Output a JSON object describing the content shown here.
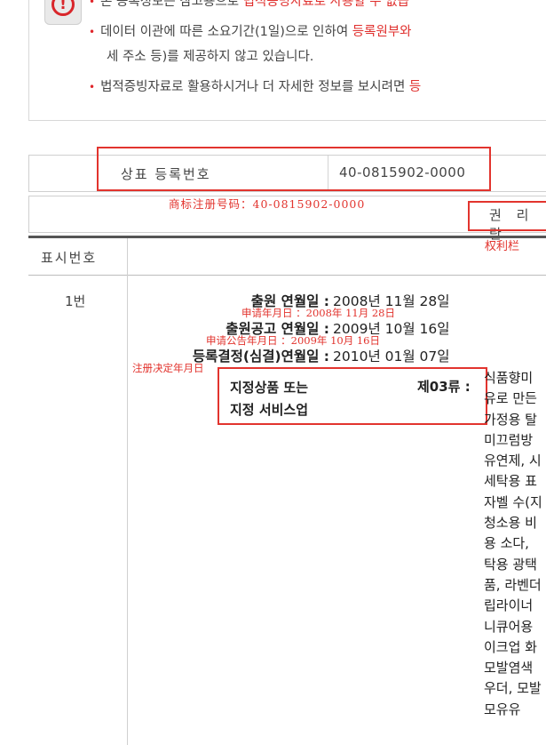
{
  "notice": {
    "line1_pre": "본 등록정보는 참고용으로 ",
    "line1_red": "법적증빙자료로 사용할 수 없습",
    "line2_pre": "데이터 이관에 따른 소요기간(1일)으로 인하여 ",
    "line2_red": "등록원부와",
    "line3": "세 주소 등)를 제공하지 않고 있습니다.",
    "line4_pre": "법적증빙자료로 활용하시거나 더 자세한 정보를 보시려면 ",
    "line4_red": "등",
    "alert_icon": "exclamation-circle"
  },
  "registration": {
    "label": "상표 등록번호",
    "value": "40-0815902-0000",
    "annotation": "商标注册号码：40-0815902-0000"
  },
  "rights": {
    "label": "권 리 란",
    "annotation": "权利栏"
  },
  "table": {
    "header_display": "표시번호",
    "row_number": "1번",
    "dates": [
      {
        "label": "출원 연월일 :",
        "value": "2008년 11월 28일",
        "annotation": "申请年月日 ：2008年 11月 28日"
      },
      {
        "label": "출원공고 연월일 :",
        "value": "2009년 10월 16일",
        "annotation": "申请公告年月日 ：2009年 10月 16日"
      },
      {
        "label": "등록결정(심결)연월일 :",
        "value": "2010년 01월 07일",
        "annotation": "注册决定年月日"
      }
    ],
    "goods_label_1": "지정상품 또는",
    "goods_label_2": "지정 서비스업",
    "class_label": "제03류 :",
    "goods_lines": [
      "식품향미",
      "유로 만든",
      "가정용 탈",
      "미끄럼방",
      "유연제, 시",
      "세탁용 표",
      "자벨 수(지",
      "청소용 비",
      "용 소다,",
      "탁용 광택",
      "품, 라벤더",
      "립라이너",
      "니큐어용",
      "이크업 화",
      "모발염색",
      "우더, 모발",
      "모유유"
    ]
  },
  "colors": {
    "accent_red": "#e2342e",
    "text": "#333333"
  }
}
